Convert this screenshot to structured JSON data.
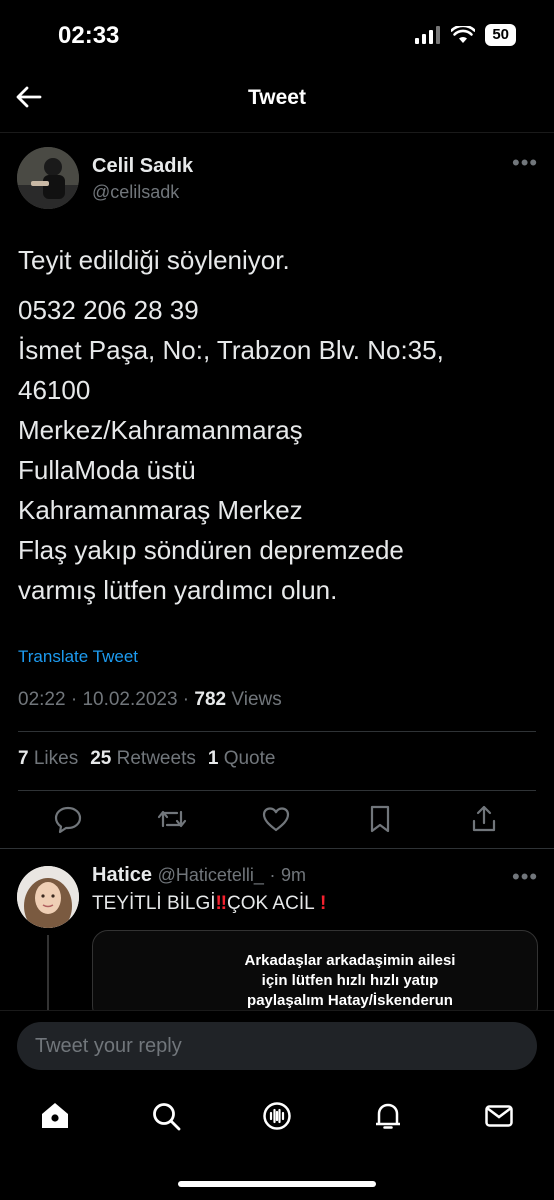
{
  "status_bar": {
    "time": "02:33",
    "battery": "50"
  },
  "header": {
    "title": "Tweet"
  },
  "tweet": {
    "author_name": "Celil Sadık",
    "author_handle": "@celilsadk",
    "text_lead": "Teyit edildiği söyleniyor.",
    "text_body": "0532 206 28 39\nİsmet Paşa, No:, Trabzon Blv. No:35,\n46100\nMerkez/Kahramanmaraş\nFullaModa üstü\nKahramanmaraş Merkez\nFlaş yakıp söndüren depremzede\nvarmış lütfen yardımcı olun.",
    "translate_label": "Translate Tweet",
    "time": "02:22",
    "date": "10.02.2023",
    "views_count": "782",
    "views_label": "Views",
    "likes_count": "7",
    "likes_label": "Likes",
    "retweets_count": "25",
    "retweets_label": "Retweets",
    "quotes_count": "1",
    "quotes_label": "Quote"
  },
  "reply": {
    "author_name": "Hatice",
    "author_handle": "@Haticetelli_",
    "age": "9m",
    "text": "TEYİTLİ BİLGİ",
    "text_end": "ÇOK ACİL",
    "card_text": "Arkadaşlar arkadaşimin ailesi\niçin lütfen hızlı hızlı yatıp\npaylaşalım Hatay/İskenderun"
  },
  "composer": {
    "placeholder": "Tweet your reply"
  },
  "colors": {
    "accent": "#1d9bf0",
    "muted": "#71767b",
    "text": "#e7e9ea",
    "alert": "#f4212e"
  },
  "nav": {
    "icons": [
      "home-icon",
      "search-icon",
      "spaces-icon",
      "notifications-icon",
      "messages-icon"
    ]
  }
}
